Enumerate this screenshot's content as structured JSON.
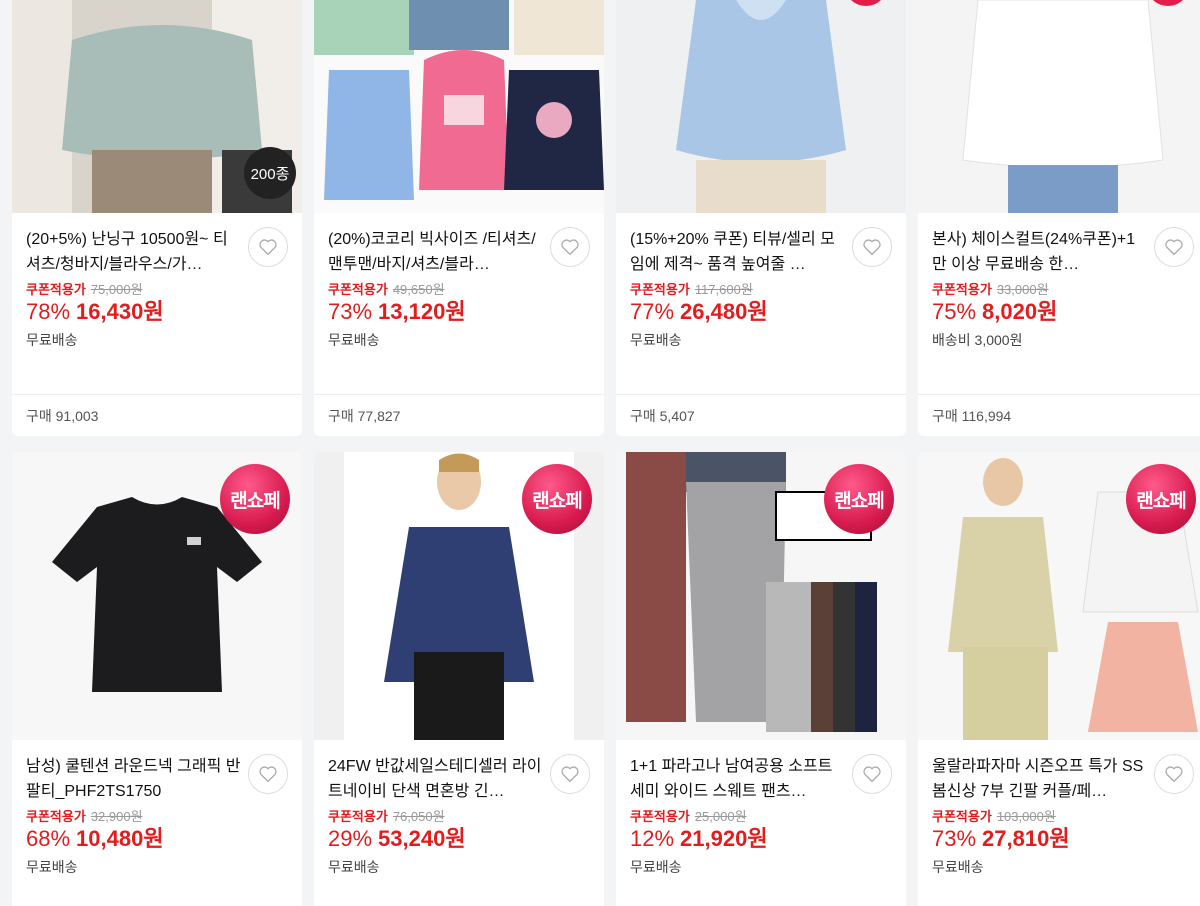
{
  "products": [
    {
      "title": "(20+5%) 난닝구 10500원~ 티셔츠/청바지/블라우스/가…",
      "coupon_label": "쿠폰적용가",
      "original": "75,000원",
      "discount": "78%",
      "price": "16,430원",
      "shipping": "무료배송",
      "purchase": "구매 91,003",
      "image_badge": "200종"
    },
    {
      "title": "(20%)코코리 빅사이즈 /티셔츠/맨투맨/바지/셔츠/블라…",
      "coupon_label": "쿠폰적용가",
      "original": "49,650원",
      "discount": "73%",
      "price": "13,120원",
      "shipping": "무료배송",
      "purchase": "구매 77,827"
    },
    {
      "title": "(15%+20% 쿠폰) 티뷰/셀리 모임에 제격~ 품격 높여줄 …",
      "coupon_label": "쿠폰적용가",
      "original": "117,600원",
      "discount": "77%",
      "price": "26,480원",
      "shipping": "무료배송",
      "purchase": "구매 5,407"
    },
    {
      "title": "본사) 체이스컬트(24%쿠폰)+1만 이상 무료배송 한…",
      "coupon_label": "쿠폰적용가",
      "original": "33,000원",
      "discount": "75%",
      "price": "8,020원",
      "shipping": "배송비 3,000원",
      "purchase": "구매 116,994"
    },
    {
      "title": "남성) 쿨텐션 라운드넥 그래픽 반팔티_PHF2TS1750",
      "coupon_label": "쿠폰적용가",
      "original": "32,900원",
      "discount": "68%",
      "price": "10,480원",
      "shipping": "무료배송",
      "image_badge": "랜쇼페"
    },
    {
      "title": "24FW 반값세일스테디셀러 라이트네이비 단색 면혼방 긴…",
      "coupon_label": "쿠폰적용가",
      "original": "76,050원",
      "discount": "29%",
      "price": "53,240원",
      "shipping": "무료배송",
      "image_badge": "랜쇼페"
    },
    {
      "title": "1+1 파라고나 남여공용 소프트 세미 와이드 스웨트 팬츠…",
      "coupon_label": "쿠폰적용가",
      "original": "25,000원",
      "discount": "12%",
      "price": "21,920원",
      "shipping": "무료배송",
      "image_badge": "랜쇼페"
    },
    {
      "title": "울랄라파자마 시즌오프 특가 SS 봄신상 7부 긴팔 커플/페…",
      "coupon_label": "쿠폰적용가",
      "original": "103,000원",
      "discount": "73%",
      "price": "27,810원",
      "shipping": "무료배송",
      "image_badge": "랜쇼페"
    }
  ],
  "icons": {
    "wishlist": "heart-icon"
  },
  "colors": {
    "accent": "#e11d1d",
    "badge": "#d81b4f"
  }
}
